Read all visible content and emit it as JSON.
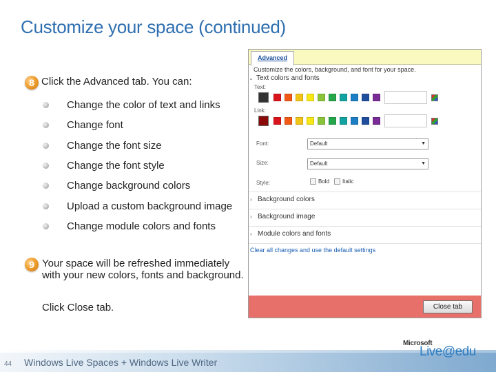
{
  "slide": {
    "title": "Customize your space (continued)",
    "page_number": "44",
    "footer_text": "Windows Live Spaces + Windows Live Writer",
    "logo_microsoft": "Microsoft",
    "logo_live": "Live@edu"
  },
  "step8": {
    "number": "8",
    "text_before": "Click the ",
    "text_bold": "Advanced",
    "text_after": " tab. You can:",
    "bullets": [
      "Change the color of text and links",
      "Change font",
      "Change the font size",
      "Change the font style",
      "Change background colors",
      "Upload a custom background image",
      "Change module colors and fonts"
    ]
  },
  "step9": {
    "number": "9",
    "text": "Your space will be refreshed immediately with your new colors, fonts and background.",
    "click_prefix": "Click ",
    "click_bold": "Close tab."
  },
  "panel": {
    "tab_label": "Advanced",
    "description": "Customize the colors, background, and font for your space.",
    "section_text_links": "Text colors and fonts",
    "label_text": "Text:",
    "label_link": "Link:",
    "text_selected_color": "#333333",
    "link_selected_color": "#8a0a0a",
    "palette": [
      "#d9141c",
      "#f05a16",
      "#f2c418",
      "#f7e716",
      "#8ac43a",
      "#26a64a",
      "#12a3a0",
      "#1c7ec4",
      "#1f4f9c",
      "#7a2c96"
    ],
    "label_font": "Font:",
    "font_value": "Default",
    "label_size": "Size:",
    "size_value": "Default",
    "label_style": "Style:",
    "style_bold": "Bold",
    "style_italic": "Italic",
    "section_background_colors": "Background colors",
    "section_background_image": "Background image",
    "section_module": "Module colors and fonts",
    "clear_link": "Clear all changes and use the default settings",
    "close_button": "Close tab",
    "chevron_open": "⌄",
    "chevron_closed": "›"
  }
}
